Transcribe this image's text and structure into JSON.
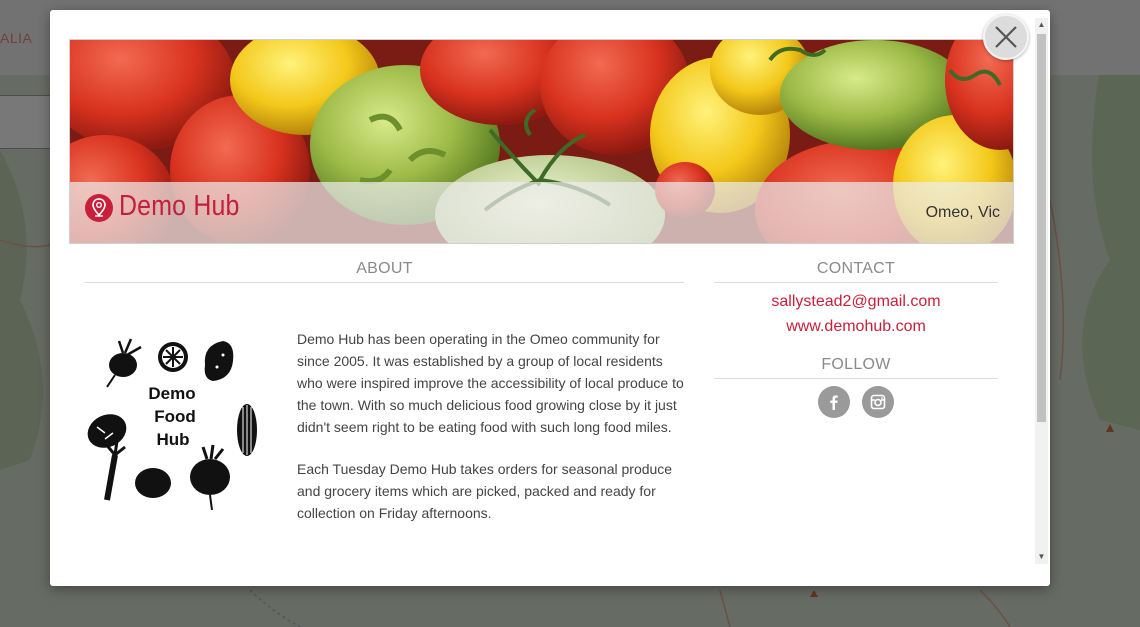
{
  "background": {
    "header_text": "ALIA"
  },
  "modal": {
    "close_icon": "close-icon",
    "banner": {
      "title": "Demo Hub",
      "location": "Omeo, Vic",
      "pin_icon": "map-pin-icon"
    },
    "about": {
      "heading": "ABOUT",
      "logo_text": [
        "Demo",
        "Food",
        "Hub"
      ],
      "paragraphs": [
        "Demo Hub has been operating in the Omeo community for since 2005. It was established by a group of local residents who were inspired improve the accessibility of local produce to the town. With so much delicious food growing close by it just didn't seem right to be eating food with such long food miles.",
        "Each Tuesday Demo Hub takes orders for seasonal produce and grocery items which are picked, packed and ready for collection on Friday afternoons."
      ]
    },
    "contact": {
      "heading": "CONTACT",
      "email": "sallystead2@gmail.com",
      "website": "www.demohub.com"
    },
    "follow": {
      "heading": "FOLLOW",
      "icons": [
        "facebook-icon",
        "instagram-icon"
      ]
    }
  },
  "colors": {
    "accent": "#c8203a",
    "heading_gray": "#8a8a8a"
  }
}
